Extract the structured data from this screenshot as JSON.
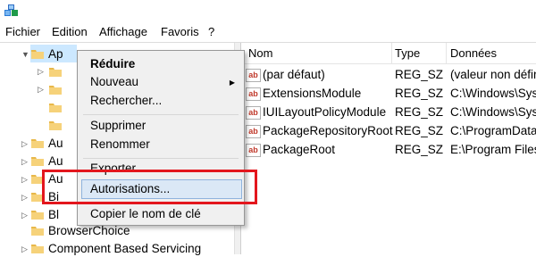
{
  "menubar": {
    "items": [
      "Fichier",
      "Edition",
      "Affichage",
      "Favoris",
      "?"
    ]
  },
  "tree": {
    "items": [
      "Ap",
      "",
      "",
      "",
      "",
      "Au",
      "Au",
      "Au",
      "Bi",
      "Bl",
      "BrowserChoice",
      "Component Based Servicing"
    ]
  },
  "list": {
    "columns": [
      "Nom",
      "Type",
      "Données"
    ],
    "rows": [
      {
        "name": "(par défaut)",
        "type": "REG_SZ",
        "data": "(valeur non défir"
      },
      {
        "name": "ExtensionsModule",
        "type": "REG_SZ",
        "data": "C:\\Windows\\Syst"
      },
      {
        "name": "IUILayoutPolicyModule",
        "type": "REG_SZ",
        "data": "C:\\Windows\\Syst"
      },
      {
        "name": "PackageRepositoryRoot",
        "type": "REG_SZ",
        "data": "C:\\ProgramData\\"
      },
      {
        "name": "PackageRoot",
        "type": "REG_SZ",
        "data": "E:\\Program Files\\"
      }
    ],
    "icon_label": "ab"
  },
  "context_menu": {
    "items": [
      "Réduire",
      "Nouveau",
      "Rechercher...",
      "Supprimer",
      "Renommer",
      "Exporter",
      "Autorisations...",
      "Copier le nom de clé"
    ],
    "highlighted": "Autorisations..."
  },
  "colors": {
    "annotation": "#e3161d",
    "highlight": "#dbe8f6",
    "folder": "#e8b84a"
  }
}
